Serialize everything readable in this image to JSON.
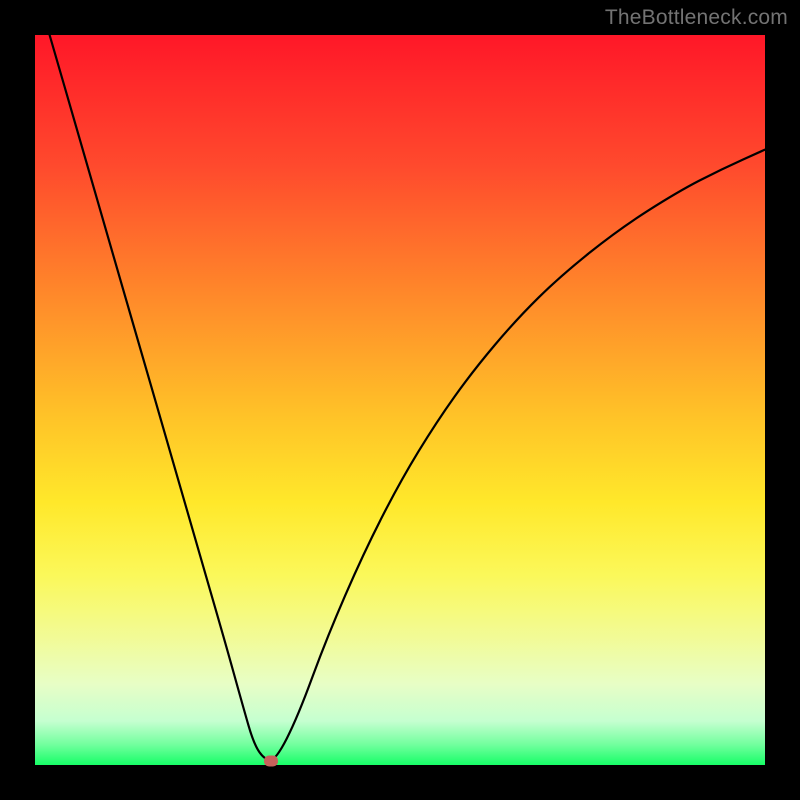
{
  "watermark": "TheBottleneck.com",
  "chart_data": {
    "type": "line",
    "title": "",
    "xlabel": "",
    "ylabel": "",
    "xlim": [
      0,
      1
    ],
    "ylim": [
      0,
      1
    ],
    "series": [
      {
        "name": "curve",
        "x": [
          0.02,
          0.06,
          0.1,
          0.14,
          0.18,
          0.22,
          0.26,
          0.285,
          0.3,
          0.315,
          0.33,
          0.36,
          0.4,
          0.45,
          0.5,
          0.55,
          0.6,
          0.66,
          0.72,
          0.8,
          0.88,
          0.94,
          1.0
        ],
        "y": [
          1.0,
          0.862,
          0.723,
          0.585,
          0.447,
          0.308,
          0.17,
          0.08,
          0.028,
          0.007,
          0.007,
          0.066,
          0.175,
          0.29,
          0.388,
          0.47,
          0.54,
          0.611,
          0.67,
          0.734,
          0.785,
          0.816,
          0.843
        ]
      }
    ],
    "marker": {
      "x": 0.323,
      "y": 0.006
    },
    "colors": {
      "curve": "#000000",
      "marker": "#c7615b",
      "gradient_top": "#ff1728",
      "gradient_bottom": "#17fe67",
      "background": "#000000",
      "watermark": "#737373"
    }
  }
}
